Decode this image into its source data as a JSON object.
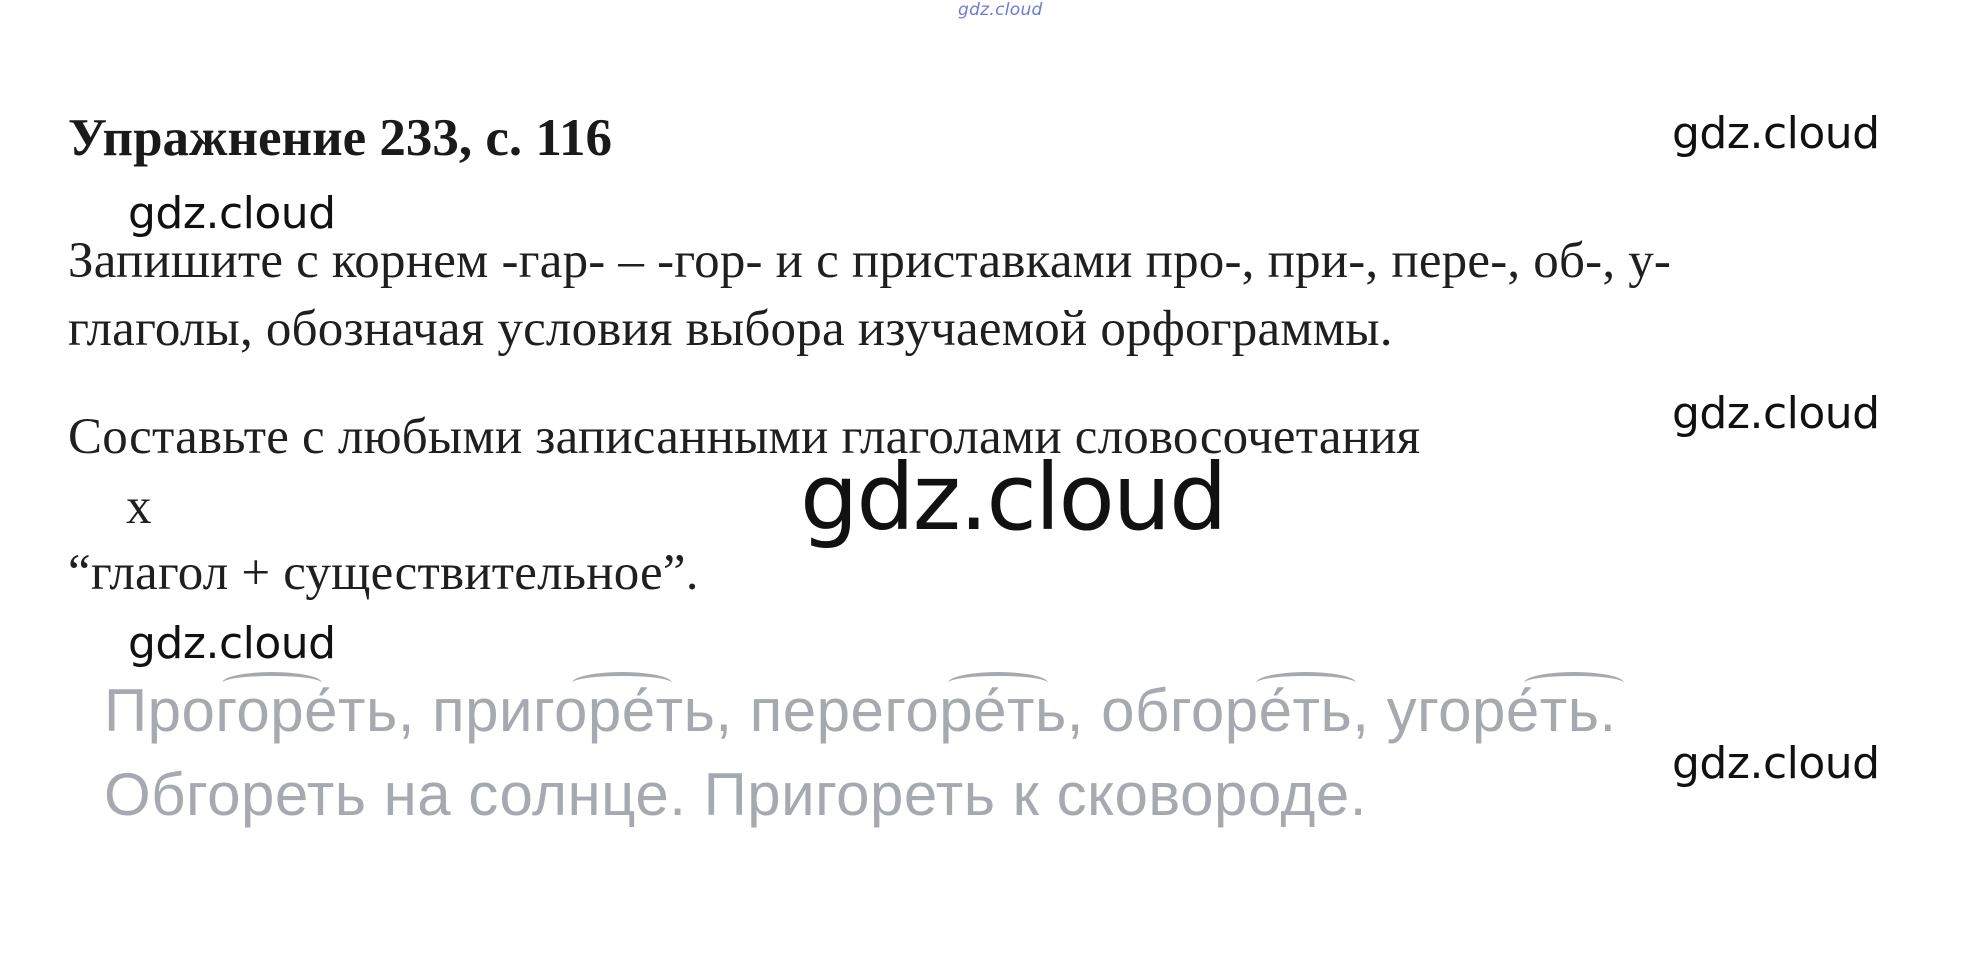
{
  "watermarks": {
    "top": "gdz.cloud",
    "right_1": "gdz.cloud",
    "left_1": "gdz.cloud",
    "right_2": "gdz.cloud",
    "center": "gdz.cloud",
    "left_2": "gdz.cloud",
    "right_3": "gdz.cloud"
  },
  "exercise": {
    "title": "Упражнение 233, с. 116",
    "task_line_1": "Запишите с корнем -гар- – -гор- и с приставками про-, при-, пере-, об-, у-",
    "task_line_2": "глаголы, обозначая условия выбора изучаемой орфограммы.",
    "task_line_3": "Составьте с любыми записанными глаголами словосочетания",
    "task_x": "x",
    "task_line_4": "“глагол + существительное”."
  },
  "answer": {
    "line_1": "Прогоре́ть, пригоре́ть, перегоре́ть, обгоре́ть, угоре́ть.",
    "line_2": "Обгореть на солнце. Пригореть к сковороде."
  }
}
